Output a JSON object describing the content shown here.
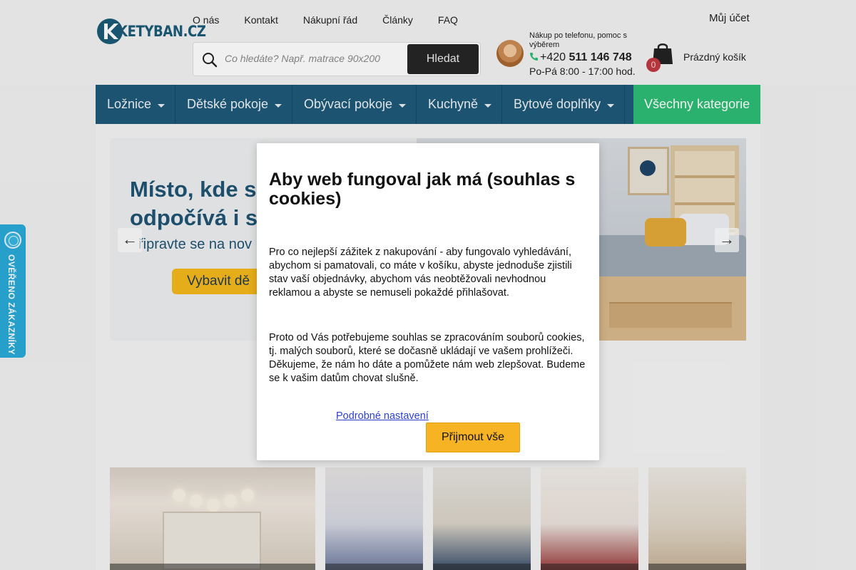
{
  "logo": {
    "text": "KETYBAN.CZ"
  },
  "topnav": [
    "O nás",
    "Kontakt",
    "Nákupní řád",
    "Články",
    "FAQ"
  ],
  "account": {
    "label": "Můj účet"
  },
  "search": {
    "placeholder": "Co hledáte? Např. matrace 90x200",
    "button": "Hledat"
  },
  "support": {
    "note": "Nákup po telefonu, pomoc s výběrem",
    "phone_prefix": "+420",
    "phone_number": "511 146 748",
    "hours": "Po-Pá 8:00 - 17:00 hod."
  },
  "cart": {
    "count": "0",
    "label": "Prázdný košík"
  },
  "categories": [
    {
      "label": "Ložnice",
      "width": 112
    },
    {
      "label": "Dětské pokoje",
      "width": 164
    },
    {
      "label": "Obývací pokoje",
      "width": 174
    },
    {
      "label": "Kuchyně",
      "width": 120
    },
    {
      "label": "Bytové doplňky",
      "width": 172
    }
  ],
  "all_categories": "Všechny kategorie",
  "banner": {
    "headline": "Místo, kde s\nodpočívá i s",
    "subline": "řipravte se na nov",
    "cta": "Vybavit dě",
    "prev": "←",
    "next": "→"
  },
  "modal": {
    "title": "Aby web fungoval jak má (souhlas s cookies)",
    "paragraph1": "Pro co nejlepší zážitek z nakupování - aby fungovalo vyhledávání, abychom si pamatovali, co máte v košíku, abyste jednoduše zjistili stav vaší objednávky, abychom vás neobtěžovali nevhodnou reklamou a abyste se nemuseli pokaždé přihlašovat.",
    "paragraph2": "Proto od Vás potřebujeme souhlas se zpracováním souborů cookies, tj. malých souborů, které se dočasně ukládají ve vašem prohlížeči. Děkujeme, že nám ho dáte a pomůžete nám web zlepšovat. Budeme se k vašim datům chovat slušně.",
    "settings_link": "Podrobné nastavení",
    "accept_button": "Přijmout vše"
  },
  "verified_widget": {
    "text": "OVĚŘENO ZÁKAZNÍKY"
  },
  "colors": {
    "nav_blue": "#1d5978",
    "nav_green": "#2dbd74",
    "accept_yellow": "#f6b324",
    "badge_red": "#c0393f",
    "widget_blue": "#2aa9d8"
  }
}
